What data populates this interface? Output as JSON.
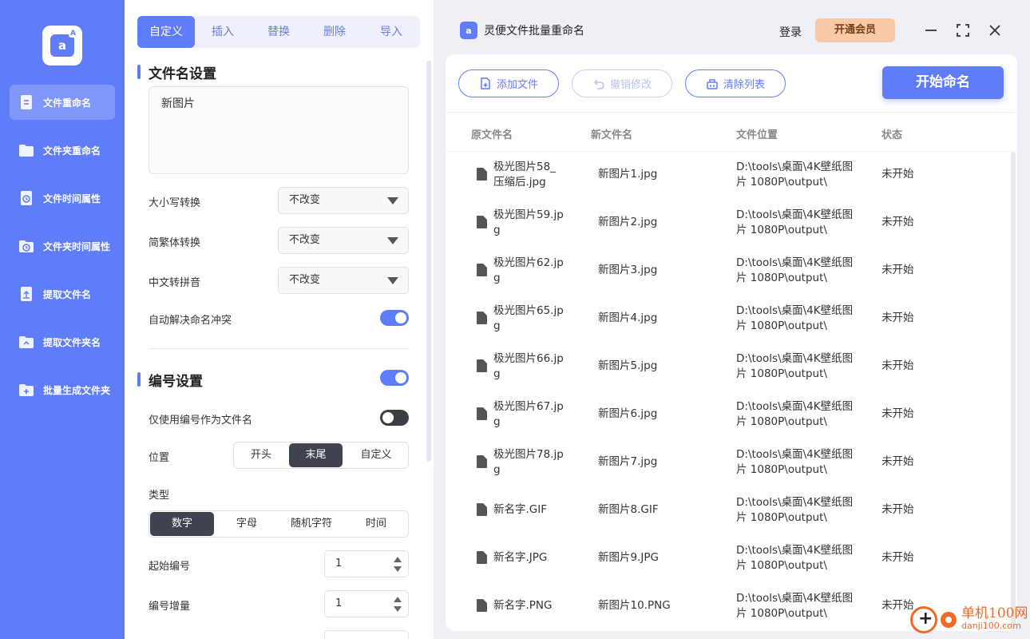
{
  "sidebar": {
    "logo_text": "a",
    "logo_sup": "A",
    "items": [
      {
        "label": "文件重命名",
        "icon": "file-doc-icon",
        "active": true
      },
      {
        "label": "文件夹重命名",
        "icon": "folder-icon",
        "active": false
      },
      {
        "label": "文件时间属性",
        "icon": "file-clock-icon",
        "active": false
      },
      {
        "label": "文件夹时间属性",
        "icon": "folder-clock-icon",
        "active": false
      },
      {
        "label": "提取文件名",
        "icon": "file-upload-icon",
        "active": false
      },
      {
        "label": "提取文件夹名",
        "icon": "folder-upload-icon",
        "active": false
      },
      {
        "label": "批量生成文件夹",
        "icon": "folder-plus-icon",
        "active": false
      }
    ]
  },
  "tabs": [
    "自定义",
    "插入",
    "替换",
    "删除",
    "导入"
  ],
  "filename_settings": {
    "title": "文件名设置",
    "name_value": "新图片",
    "case_label": "大小写转换",
    "case_value": "不改变",
    "trad_label": "简繁体转换",
    "trad_value": "不改变",
    "pinyin_label": "中文转拼音",
    "pinyin_value": "不改变",
    "conflict_label": "自动解决命名冲突",
    "conflict_on": true
  },
  "numbering": {
    "title": "编号设置",
    "enabled": true,
    "only_number_label": "仅使用编号作为文件名",
    "only_number_on": false,
    "position_label": "位置",
    "positions": [
      "开头",
      "末尾",
      "自定义"
    ],
    "position_selected": "末尾",
    "type_label": "类型",
    "types": [
      "数字",
      "字母",
      "随机字符",
      "时间"
    ],
    "type_selected": "数字",
    "start_label": "起始编号",
    "start_value": "1",
    "step_label": "编号增量",
    "step_value": "1"
  },
  "header": {
    "app_title": "灵便文件批量重命名",
    "app_icon_text": "a",
    "login": "登录",
    "vip": "开通会员"
  },
  "toolbar": {
    "add": "添加文件",
    "undo": "撤销修改",
    "clear": "清除列表",
    "start": "开始命名"
  },
  "table": {
    "headers": [
      "原文件名",
      "新文件名",
      "文件位置",
      "状态"
    ],
    "rows": [
      {
        "orig": [
          "极光图片58_",
          "压缩后.jpg"
        ],
        "new": "新图片1.jpg",
        "loc": [
          "D:\\tools\\桌面\\4K壁纸图",
          "片 1080P\\output\\"
        ],
        "status": "未开始"
      },
      {
        "orig": [
          "极光图片59.jp",
          "g"
        ],
        "new": "新图片2.jpg",
        "loc": [
          "D:\\tools\\桌面\\4K壁纸图",
          "片 1080P\\output\\"
        ],
        "status": "未开始"
      },
      {
        "orig": [
          "极光图片62.jp",
          "g"
        ],
        "new": "新图片3.jpg",
        "loc": [
          "D:\\tools\\桌面\\4K壁纸图",
          "片 1080P\\output\\"
        ],
        "status": "未开始"
      },
      {
        "orig": [
          "极光图片65.jp",
          "g"
        ],
        "new": "新图片4.jpg",
        "loc": [
          "D:\\tools\\桌面\\4K壁纸图",
          "片 1080P\\output\\"
        ],
        "status": "未开始"
      },
      {
        "orig": [
          "极光图片66.jp",
          "g"
        ],
        "new": "新图片5.jpg",
        "loc": [
          "D:\\tools\\桌面\\4K壁纸图",
          "片 1080P\\output\\"
        ],
        "status": "未开始"
      },
      {
        "orig": [
          "极光图片67.jp",
          "g"
        ],
        "new": "新图片6.jpg",
        "loc": [
          "D:\\tools\\桌面\\4K壁纸图",
          "片 1080P\\output\\"
        ],
        "status": "未开始"
      },
      {
        "orig": [
          "极光图片78.jp",
          "g"
        ],
        "new": "新图片7.jpg",
        "loc": [
          "D:\\tools\\桌面\\4K壁纸图",
          "片 1080P\\output\\"
        ],
        "status": "未开始"
      },
      {
        "orig": [
          "新名字.GIF"
        ],
        "new": "新图片8.GIF",
        "loc": [
          "D:\\tools\\桌面\\4K壁纸图",
          "片 1080P\\output\\"
        ],
        "status": "未开始"
      },
      {
        "orig": [
          "新名字.JPG"
        ],
        "new": "新图片9.JPG",
        "loc": [
          "D:\\tools\\桌面\\4K壁纸图",
          "片 1080P\\output\\"
        ],
        "status": "未开始"
      },
      {
        "orig": [
          "新名字.PNG"
        ],
        "new": "新图片10.PNG",
        "loc": [
          "D:\\tools\\桌面\\4K壁纸图",
          "片 1080P\\output\\"
        ],
        "status": "未开始"
      }
    ]
  },
  "watermark": {
    "big": "单机100网",
    "small": "danji100.com"
  },
  "colors": {
    "accent": "#5f7cf9",
    "vip_bg": "#f8c9a8",
    "watermark": "#f06a24"
  }
}
